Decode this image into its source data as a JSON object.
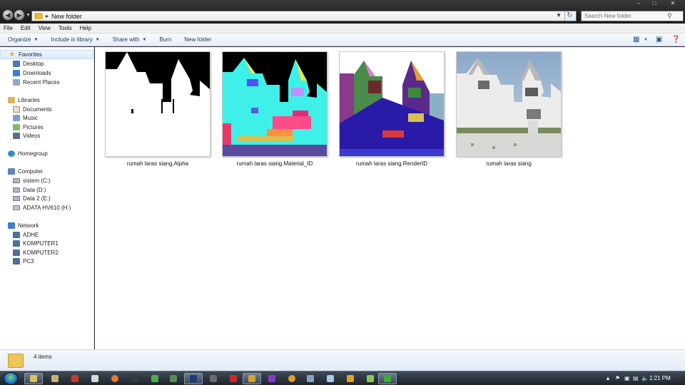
{
  "address": {
    "path": "New folder"
  },
  "search": {
    "placeholder": "Search New folder"
  },
  "menu": [
    "File",
    "Edit",
    "View",
    "Tools",
    "Help"
  ],
  "toolbar": {
    "organize": "Organize",
    "include": "Include in library",
    "share": "Share with",
    "burn": "Burn",
    "new_folder": "New folder"
  },
  "nav": {
    "favorites": "Favorites",
    "favorites_items": [
      "Desktop",
      "Downloads",
      "Recent Places"
    ],
    "libraries": "Libraries",
    "libraries_items": [
      "Documents",
      "Music",
      "Pictures",
      "Videos"
    ],
    "homegroup": "Homegroup",
    "computer": "Computer",
    "computer_items": [
      "sistem (C:)",
      "Data (D:)",
      "Data 2 (E:)",
      "ADATA HV610 (H:)"
    ],
    "network": "Network",
    "network_items": [
      "ADHE",
      "KOMPUTER1",
      "KOMPUTER2",
      "PC3"
    ]
  },
  "files": [
    "rumah laras siang.Alpha",
    "rumah laras siang.Material_ID",
    "rumah laras siang.RenderID",
    "rumah laras siang"
  ],
  "details": {
    "count": "4 items"
  },
  "taskbar": {
    "time": "1:21 PM"
  }
}
